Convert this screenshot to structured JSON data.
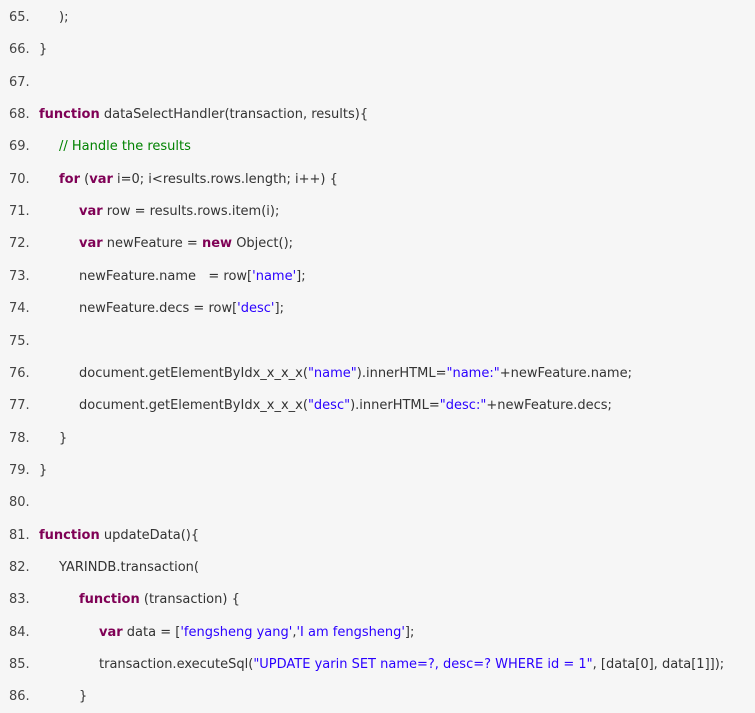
{
  "code": {
    "lines": [
      {
        "num": "65.",
        "indent": 1,
        "tokens": [
          {
            "t": "plain",
            "v": ");"
          }
        ]
      },
      {
        "num": "66.",
        "indent": 0,
        "tokens": [
          {
            "t": "plain",
            "v": "}"
          }
        ]
      },
      {
        "num": "67.",
        "indent": 0,
        "tokens": []
      },
      {
        "num": "68.",
        "indent": 0,
        "tokens": [
          {
            "t": "kw",
            "v": "function"
          },
          {
            "t": "plain",
            "v": " dataSelectHandler(transaction, results){"
          }
        ]
      },
      {
        "num": "69.",
        "indent": 1,
        "tokens": [
          {
            "t": "cm",
            "v": "// Handle the results"
          }
        ]
      },
      {
        "num": "70.",
        "indent": 1,
        "tokens": [
          {
            "t": "kw",
            "v": "for"
          },
          {
            "t": "plain",
            "v": " ("
          },
          {
            "t": "kw",
            "v": "var"
          },
          {
            "t": "plain",
            "v": " i=0; i<results.rows.length; i++) {"
          }
        ]
      },
      {
        "num": "71.",
        "indent": 2,
        "tokens": [
          {
            "t": "kw",
            "v": "var"
          },
          {
            "t": "plain",
            "v": " row = results.rows.item(i);"
          }
        ]
      },
      {
        "num": "72.",
        "indent": 2,
        "tokens": [
          {
            "t": "kw",
            "v": "var"
          },
          {
            "t": "plain",
            "v": " newFeature = "
          },
          {
            "t": "kw",
            "v": "new"
          },
          {
            "t": "plain",
            "v": " Object();"
          }
        ]
      },
      {
        "num": "73.",
        "indent": 2,
        "tokens": [
          {
            "t": "plain",
            "v": "newFeature.name   = row["
          },
          {
            "t": "str",
            "v": "'name'"
          },
          {
            "t": "plain",
            "v": "];"
          }
        ]
      },
      {
        "num": "74.",
        "indent": 2,
        "tokens": [
          {
            "t": "plain",
            "v": "newFeature.decs = row["
          },
          {
            "t": "str",
            "v": "'desc'"
          },
          {
            "t": "plain",
            "v": "];"
          }
        ]
      },
      {
        "num": "75.",
        "indent": 0,
        "tokens": []
      },
      {
        "num": "76.",
        "indent": 2,
        "tokens": [
          {
            "t": "plain",
            "v": "document.getElementByIdx_x_x_x("
          },
          {
            "t": "str",
            "v": "\"name\""
          },
          {
            "t": "plain",
            "v": ").innerHTML="
          },
          {
            "t": "str",
            "v": "\"name:\""
          },
          {
            "t": "plain",
            "v": "+newFeature.name;"
          }
        ]
      },
      {
        "num": "77.",
        "indent": 2,
        "tokens": [
          {
            "t": "plain",
            "v": "document.getElementByIdx_x_x_x("
          },
          {
            "t": "str",
            "v": "\"desc\""
          },
          {
            "t": "plain",
            "v": ").innerHTML="
          },
          {
            "t": "str",
            "v": "\"desc:\""
          },
          {
            "t": "plain",
            "v": "+newFeature.decs;"
          }
        ]
      },
      {
        "num": "78.",
        "indent": 1,
        "tokens": [
          {
            "t": "plain",
            "v": "}"
          }
        ]
      },
      {
        "num": "79.",
        "indent": 0,
        "tokens": [
          {
            "t": "plain",
            "v": "}"
          }
        ]
      },
      {
        "num": "80.",
        "indent": 0,
        "tokens": []
      },
      {
        "num": "81.",
        "indent": 0,
        "tokens": [
          {
            "t": "kw",
            "v": "function"
          },
          {
            "t": "plain",
            "v": " updateData(){"
          }
        ]
      },
      {
        "num": "82.",
        "indent": 1,
        "tokens": [
          {
            "t": "plain",
            "v": "YARINDB.transaction("
          }
        ]
      },
      {
        "num": "83.",
        "indent": 2,
        "tokens": [
          {
            "t": "kw",
            "v": "function"
          },
          {
            "t": "plain",
            "v": " (transaction) {"
          }
        ]
      },
      {
        "num": "84.",
        "indent": 3,
        "tokens": [
          {
            "t": "kw",
            "v": "var"
          },
          {
            "t": "plain",
            "v": " data = ["
          },
          {
            "t": "str",
            "v": "'fengsheng yang'"
          },
          {
            "t": "plain",
            "v": ","
          },
          {
            "t": "str",
            "v": "'I am fengsheng'"
          },
          {
            "t": "plain",
            "v": "];"
          }
        ]
      },
      {
        "num": "85.",
        "indent": 3,
        "tokens": [
          {
            "t": "plain",
            "v": "transaction.executeSql("
          },
          {
            "t": "str",
            "v": "\"UPDATE yarin SET name=?, desc=? WHERE id = 1\""
          },
          {
            "t": "plain",
            "v": ", [data[0], data[1]]);"
          }
        ]
      },
      {
        "num": "86.",
        "indent": 2,
        "tokens": [
          {
            "t": "plain",
            "v": "}"
          }
        ]
      }
    ]
  }
}
